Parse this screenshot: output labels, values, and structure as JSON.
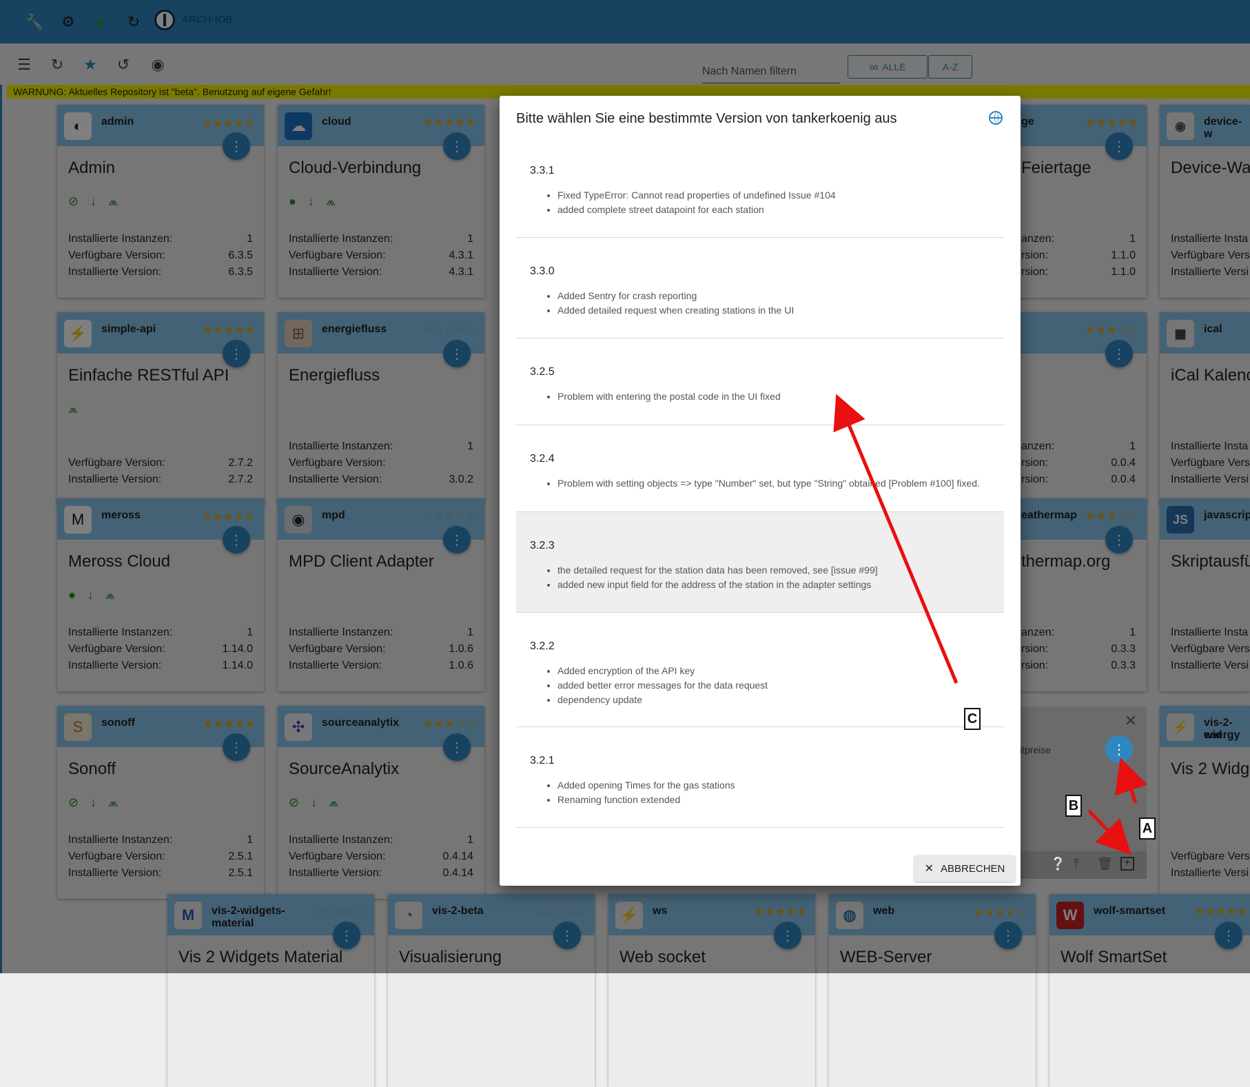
{
  "topbar": {
    "host": "ARCH-IOB",
    "icons": [
      "wrench-icon",
      "gear-icon",
      "head-icon",
      "sync-off-icon"
    ]
  },
  "toolbar": {
    "filter_placeholder": "Nach Namen filtern",
    "all_label": "ALLE",
    "az_label": "A-Z"
  },
  "warning": "WARNUNG: Aktuelles Repository ist \"beta\". Benutzung auf eigene Gefahr!",
  "labels": {
    "installed_instances": "Installierte Instanzen:",
    "available_version": "Verfügbare Version:",
    "installed_version": "Installierte Version:"
  },
  "cards": [
    {
      "name": "admin",
      "title": "Admin",
      "stars": "★★★★⯪",
      "inst": "1",
      "avail": "6.3.5",
      "installed": "6.3.5"
    },
    {
      "name": "cloud",
      "title": "Cloud-Verbindung",
      "stars": "★★★★★",
      "inst": "1",
      "avail": "4.3.1",
      "installed": "4.3.1"
    },
    {
      "name": "simple-api",
      "title": "Einfache RESTful API",
      "stars": "★★★★★",
      "avail": "2.7.2",
      "installed": "2.7.2"
    },
    {
      "name": "energiefluss",
      "title": "Energiefluss",
      "stars": "☆☆☆☆☆",
      "inst": "1",
      "avail": "",
      "installed": "3.0.2"
    },
    {
      "name": "meross",
      "title": "Meross Cloud",
      "stars": "★★★★⯪",
      "inst": "1",
      "avail": "1.14.0",
      "installed": "1.14.0"
    },
    {
      "name": "mpd",
      "title": "MPD Client Adapter",
      "stars": "☆☆☆☆☆",
      "inst": "1",
      "avail": "1.0.6",
      "installed": "1.0.6"
    },
    {
      "name": "sonoff",
      "title": "Sonoff",
      "stars": "★★★★★",
      "inst": "1",
      "avail": "2.5.1",
      "installed": "2.5.1"
    },
    {
      "name": "sourceanalytix",
      "title": "SourceAnalytix",
      "stars": "★★★☆☆",
      "inst": "1",
      "avail": "0.4.14",
      "installed": "0.4.14"
    }
  ],
  "right_cards": [
    {
      "name": "ge",
      "title": "Feiertage",
      "stars": "★★★★★",
      "inst": "1",
      "avail": "1.1.0",
      "installed": "1.1.0"
    },
    {
      "name": "",
      "title": "",
      "stars": "★★★☆☆",
      "inst": "1",
      "avail": "0.0.4",
      "installed": "0.0.4"
    },
    {
      "name": "eathermap",
      "title": "thermap.org",
      "stars": "★★★☆☆",
      "inst": "1",
      "avail": "0.3.3",
      "installed": "0.3.3"
    },
    {
      "name": "",
      "title": "",
      "subtitle": "itpreise"
    }
  ],
  "right_frag": {
    "tail_inst": "anzen:",
    "tail_avail": "rsion:",
    "tail_installed": "rsion:"
  },
  "far_cards": [
    {
      "name": "device-w",
      "title": "Device-Wa"
    },
    {
      "name": "ical",
      "title": "iCal Kalenc"
    },
    {
      "name": "javascrip",
      "title": "Skriptausfü"
    },
    {
      "name": "vis-2-wid",
      "name2": "energy",
      "title": "Vis 2 Widg"
    }
  ],
  "far_frag": {
    "inst": "Installierte Insta",
    "avail": "Verfügbare Vers",
    "installed": "Installierte Versi"
  },
  "bottom_cards": [
    {
      "name": "vis-2-widgets-",
      "name2": "material",
      "title": "Vis 2 Widgets Material",
      "stars": "☆☆☆☆☆"
    },
    {
      "name": "vis-2-beta",
      "title": "Visualisierung",
      "stars": "☆☆☆☆☆"
    },
    {
      "name": "ws",
      "title": "Web socket",
      "stars": "★★★★★"
    },
    {
      "name": "web",
      "title": "WEB-Server",
      "stars": "★★★⯪☆"
    },
    {
      "name": "wolf-smartset",
      "title": "Wolf SmartSet",
      "stars": "★★★★★"
    }
  ],
  "dialog": {
    "title": "Bitte wählen Sie eine bestimmte Version von tankerkoenig aus",
    "cancel_label": "ABBRECHEN",
    "versions": [
      {
        "version": "3.3.1",
        "notes": [
          "Fixed TypeError: Cannot read properties of undefined Issue #104",
          "added complete street datapoint for each station"
        ]
      },
      {
        "version": "3.3.0",
        "notes": [
          "Added Sentry for crash reporting",
          "Added detailed request when creating stations in the UI"
        ]
      },
      {
        "version": "3.2.5",
        "notes": [
          "Problem with entering the postal code in the UI fixed"
        ]
      },
      {
        "version": "3.2.4",
        "notes": [
          "Problem with setting objects => type \"Number\" set, but type \"String\" obtained [Problem #100] fixed."
        ]
      },
      {
        "version": "3.2.3",
        "notes": [
          "the detailed request for the station data has been removed, see [issue #99]",
          "added new input field for the address of the station in the adapter settings"
        ]
      },
      {
        "version": "3.2.2",
        "notes": [
          "Added encryption of the API key",
          "added better error messages for the data request",
          "dependency update"
        ]
      },
      {
        "version": "3.2.1",
        "notes": [
          "Added opening Times for the gas stations",
          "Renaming function extended"
        ]
      }
    ]
  },
  "annotations": {
    "a": "A",
    "b": "B",
    "c": "C",
    "color": "#e81010"
  }
}
